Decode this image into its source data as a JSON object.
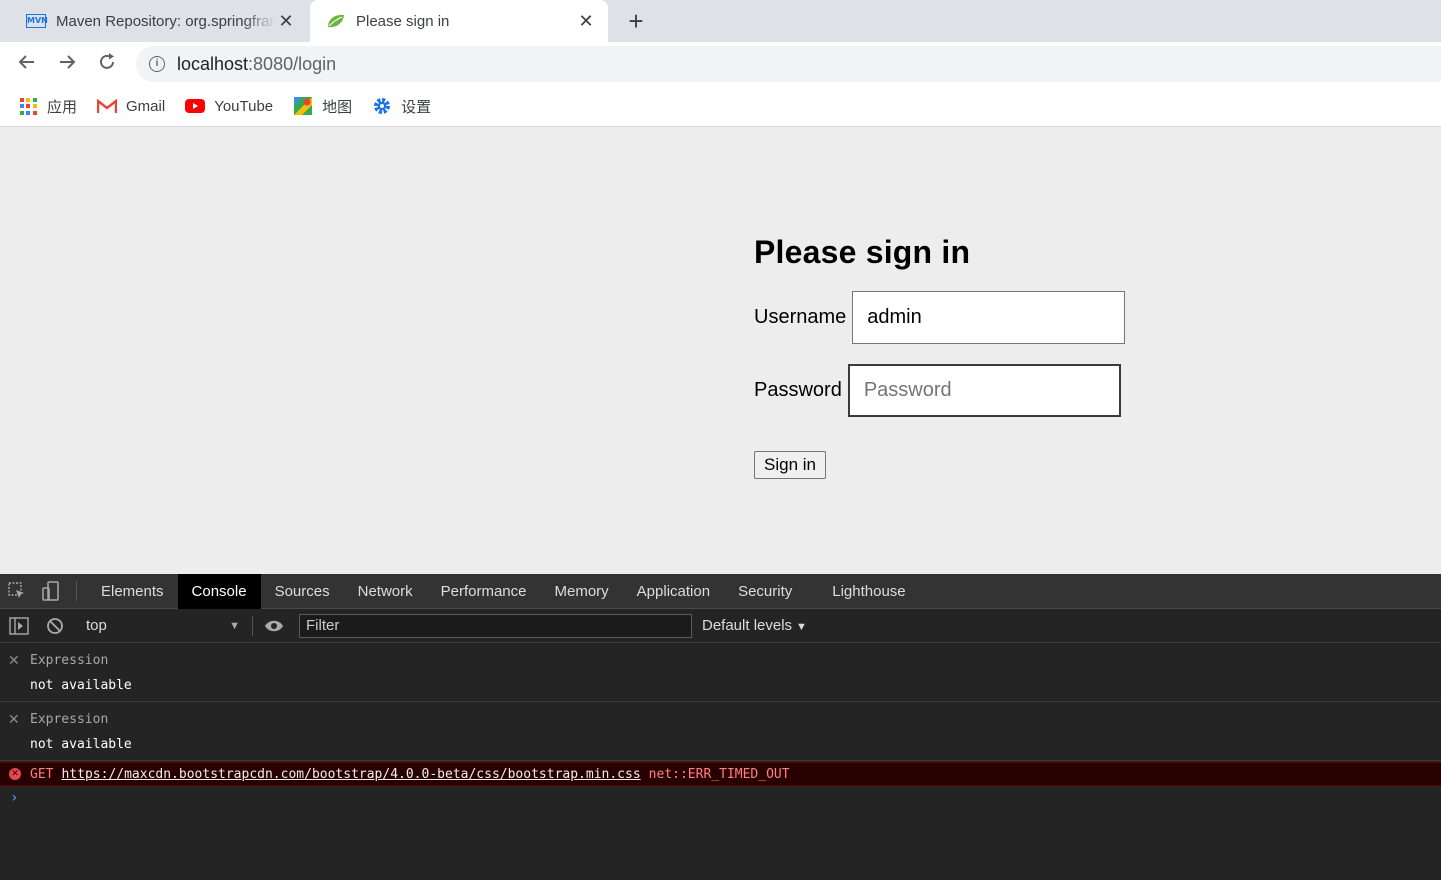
{
  "browser": {
    "tabs": [
      {
        "title": "Maven Repository: org.springframework",
        "favicon": "mvn-icon",
        "active": false
      },
      {
        "title": "Please sign in",
        "favicon": "spring-leaf-icon",
        "active": true
      }
    ],
    "close_glyph": "✕",
    "new_tab_glyph": "+",
    "url_host": "localhost",
    "url_rest": ":8080/login",
    "bookmarks": [
      {
        "label": "应用",
        "icon": "apps-grid-icon"
      },
      {
        "label": "Gmail",
        "icon": "gmail-icon"
      },
      {
        "label": "YouTube",
        "icon": "youtube-icon"
      },
      {
        "label": "地图",
        "icon": "maps-icon"
      },
      {
        "label": "设置",
        "icon": "settings-gear-icon"
      }
    ]
  },
  "login": {
    "heading": "Please sign in",
    "username_label": "Username",
    "username_value": "admin",
    "password_label": "Password",
    "password_placeholder": "Password",
    "submit_label": "Sign in"
  },
  "devtools": {
    "tabs": [
      "Elements",
      "Console",
      "Sources",
      "Network",
      "Performance",
      "Memory",
      "Application",
      "Security",
      "Lighthouse"
    ],
    "active_tab": "Console",
    "context": "top",
    "filter_placeholder": "Filter",
    "levels_label": "Default levels",
    "expressions": [
      {
        "name": "Expression",
        "value": "not available"
      },
      {
        "name": "Expression",
        "value": "not available"
      }
    ],
    "error": {
      "method": "GET",
      "url": "https://maxcdn.bootstrapcdn.com/bootstrap/4.0.0-beta/css/bootstrap.min.css",
      "message": "net::ERR_TIMED_OUT"
    },
    "prompt_glyph": "›"
  },
  "colors": {
    "accent": "#1a73e8",
    "devtools_bg": "#242424",
    "error_bg": "#290000",
    "error_text": "#ff8080",
    "page_bg": "#ededed"
  }
}
